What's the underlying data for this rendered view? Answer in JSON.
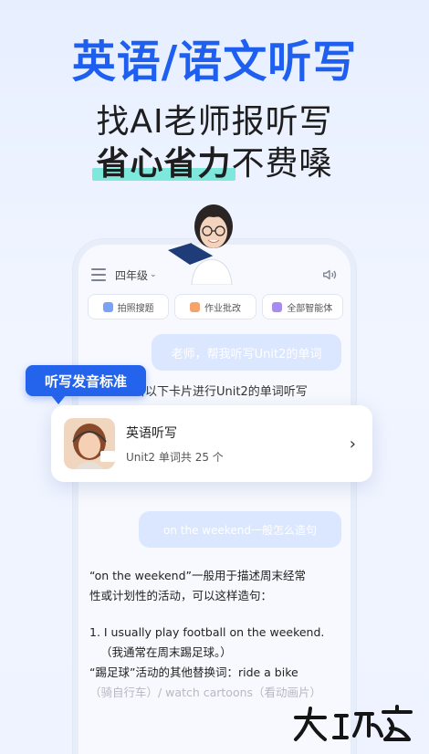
{
  "headline": "英语/语文听写",
  "subheadline_1": "找AI老师报听写",
  "subheadline_2_highlight": "省心省力",
  "subheadline_2_rest": "不费嗓",
  "app": {
    "grade_selector": "四年级",
    "chips": [
      {
        "label": "拍照搜题",
        "icon": "camera-search-icon",
        "color": "#7aa2f7"
      },
      {
        "label": "作业批改",
        "icon": "homework-check-icon",
        "color": "#f5a26b"
      },
      {
        "label": "全部智能体",
        "icon": "agents-icon",
        "color": "#a88bf0"
      }
    ],
    "user_message_1": "老师，帮我听写Unit2的单词",
    "ai_message_1": "击以下卡片进行Unit2的单词听写",
    "user_message_2": "on the weekend一般怎么造句",
    "answer": {
      "line1": "“on the weekend”一般用于描述周末经常",
      "line2": "性或计划性的活动，可以这样造句：",
      "line3": "1. I usually play football on the weekend.",
      "line4": "（我通常在周末踢足球。）",
      "line5": "“踢足球”活动的其他替换词：ride a bike",
      "line6": "（骑自行车）/ watch cartoons（看动画片）"
    }
  },
  "callout": "听写发音标准",
  "card": {
    "title": "英语听写",
    "subtitle": "Unit2 单词共 25 个",
    "chevron": "›"
  },
  "watermark": "大玩家",
  "colors": {
    "brand_blue": "#1f5ff0",
    "callout_blue": "#2463eb",
    "highlight_teal": "#7fe8dd"
  }
}
